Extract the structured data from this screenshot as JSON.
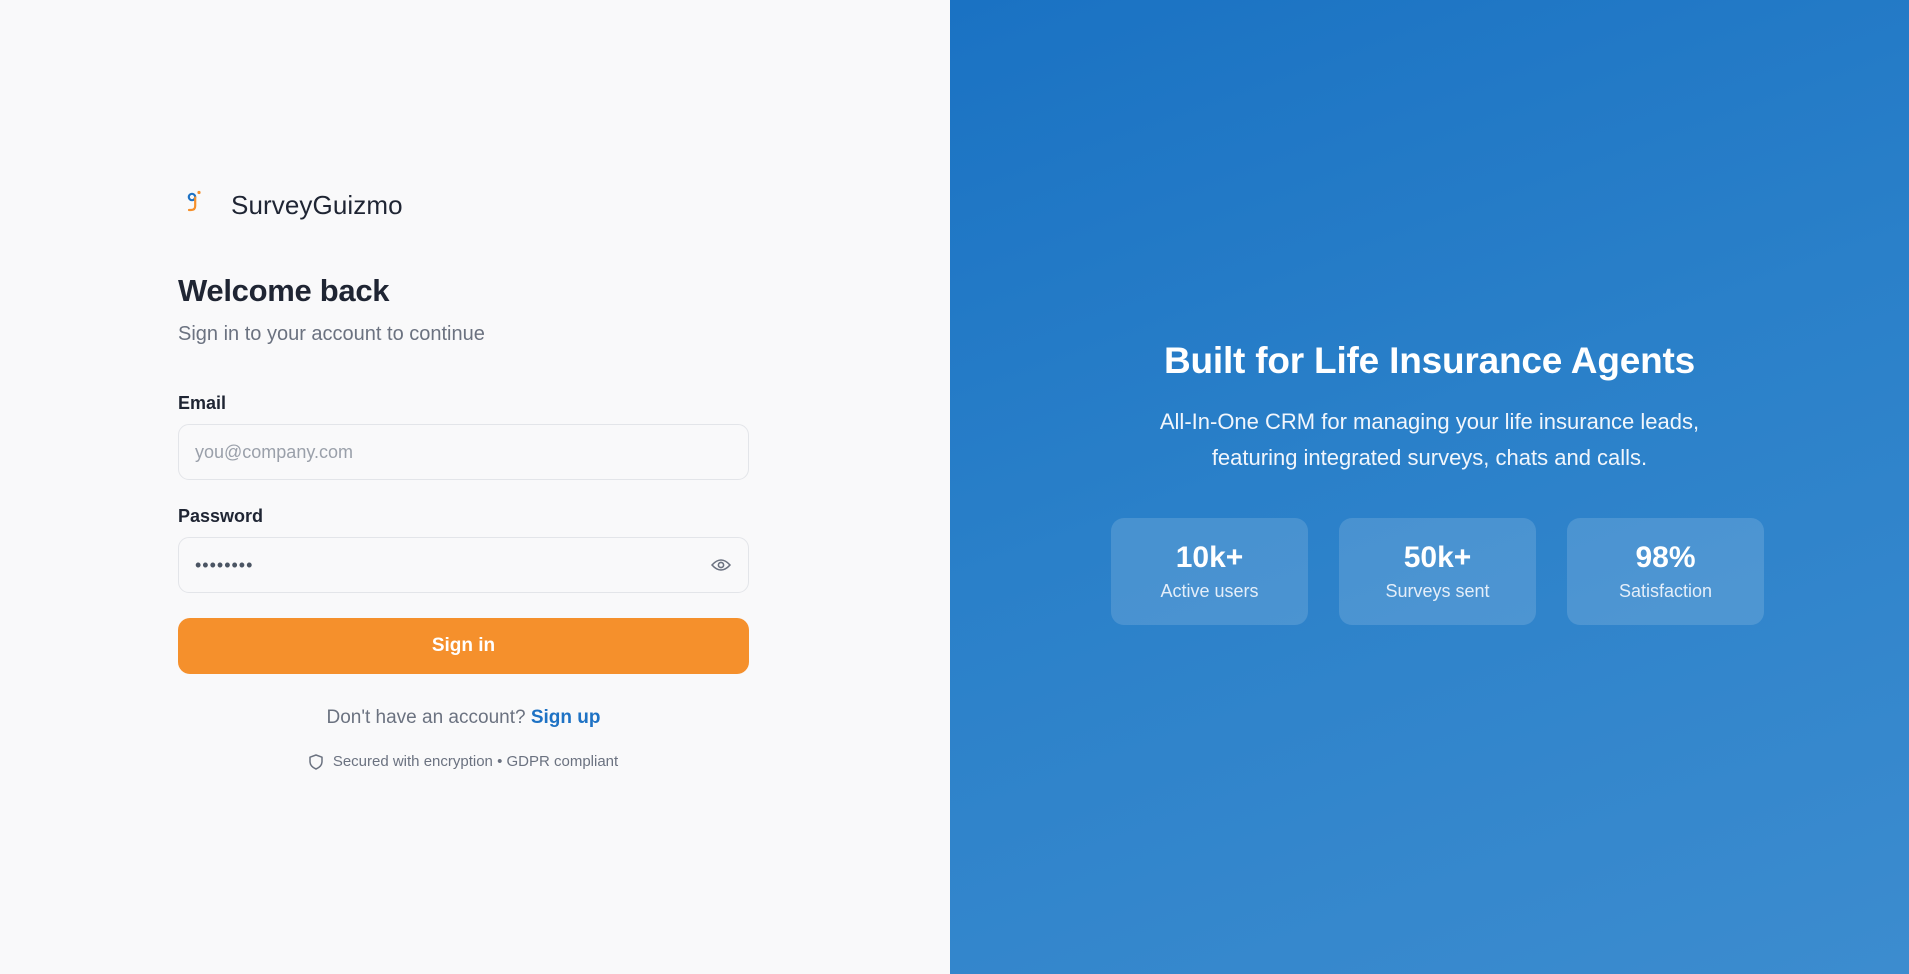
{
  "brand": {
    "name": "SurveyGuizmo",
    "logo_icon": "survey-guizmo-logo-icon",
    "colors": {
      "logo_blue": "#1e72c4",
      "logo_orange": "#f5902c"
    }
  },
  "login": {
    "title": "Welcome back",
    "subtitle": "Sign in to your account to continue",
    "email_label": "Email",
    "email_placeholder": "you@company.com",
    "email_value": "",
    "password_label": "Password",
    "password_value": "••••••••",
    "password_toggle_icon": "eye-icon",
    "signin_label": "Sign in",
    "signup_prompt": "Don't have an account?",
    "signup_link": "Sign up",
    "security_icon": "shield-icon",
    "security_note": "Secured with encryption • GDPR compliant"
  },
  "hero": {
    "title": "Built for Life Insurance Agents",
    "description_line1": "All-In-One CRM for managing your life insurance leads,",
    "description_line2": "featuring integrated surveys, chats and calls.",
    "stats": [
      {
        "value": "10k+",
        "label": "Active users"
      },
      {
        "value": "50k+",
        "label": "Surveys sent"
      },
      {
        "value": "98%",
        "label": "Satisfaction"
      }
    ]
  },
  "theme": {
    "accent": "#f5902c",
    "link": "#1e72c4",
    "panel_gradient_start": "#1a72c3",
    "panel_gradient_end": "#3c8ccf",
    "page_background": "#f9f9fa"
  }
}
